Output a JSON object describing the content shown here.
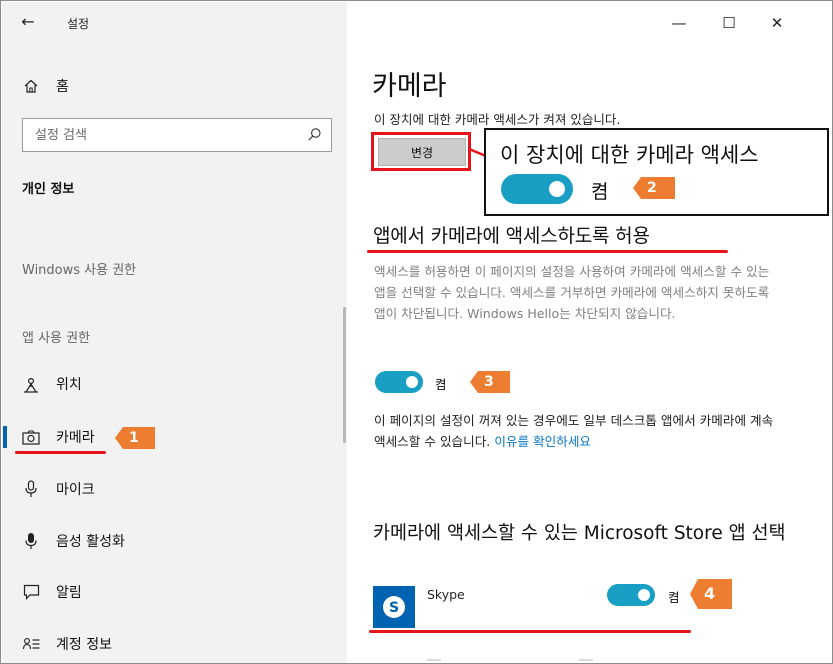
{
  "window": {
    "title": "설정",
    "minimize_glyph": "—",
    "maximize_glyph": "☐",
    "close_glyph": "✕",
    "back_glyph": "←"
  },
  "sidebar": {
    "home_label": "홈",
    "search_placeholder": "설정 검색",
    "section_title": "개인 정보",
    "group_windows": "Windows 사용 권한",
    "group_apps": "앱 사용 권한",
    "items": [
      {
        "label": "위치",
        "icon": "location-icon"
      },
      {
        "label": "카메라",
        "icon": "camera-icon",
        "active": true
      },
      {
        "label": "마이크",
        "icon": "microphone-icon"
      },
      {
        "label": "음성 활성화",
        "icon": "voice-icon"
      },
      {
        "label": "알림",
        "icon": "notification-icon"
      },
      {
        "label": "계정 정보",
        "icon": "account-info-icon"
      }
    ]
  },
  "main": {
    "title": "카메라",
    "device_status": "이 장치에 대한 카메라 액세스가 켜져 있습니다.",
    "change_button": "변경",
    "apps_heading": "앱에서 카메라에 액세스하도록 허용",
    "apps_description": "액세스를 허용하면 이 페이지의 설정을 사용하여 카메라에 액세스할 수 있는 앱을 선택할 수 있습니다. 액세스를 거부하면 카메라에 액세스하지 못하도록 앱이 차단됩니다. Windows Hello는 차단되지 않습니다.",
    "apps_toggle_label": "켬",
    "desktop_note": "이 페이지의 설정이 꺼져 있는 경우에도 일부 데스크톱 앱에서 카메라에 계속 액세스할 수 있습니다.",
    "learn_more_link": "이유를 확인하세요",
    "store_heading": "카메라에 액세스할 수 있는 Microsoft Store 앱 선택",
    "store_apps": [
      {
        "name": "Skype",
        "toggle_label": "켬",
        "icon_letter": "S"
      }
    ]
  },
  "annotations": {
    "callout_title": "이 장치에 대한 카메라 액세스",
    "callout_toggle_label": "켬",
    "step_badges": [
      "1",
      "2",
      "3",
      "4"
    ],
    "highlight_color": "#e8141b",
    "badge_color": "#ed7d31"
  },
  "colors": {
    "accent": "#1a9fc4",
    "sidebar_bg": "#f2f2f2",
    "link": "#0a78c8",
    "skype_tile": "#0063b1"
  }
}
